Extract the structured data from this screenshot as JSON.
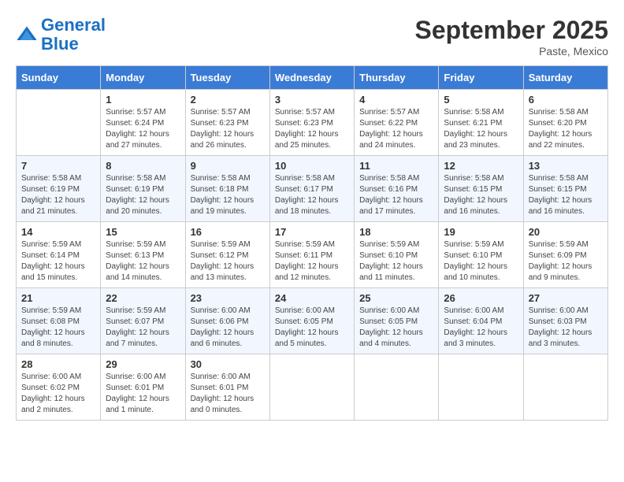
{
  "logo": {
    "line1": "General",
    "line2": "Blue"
  },
  "title": "September 2025",
  "subtitle": "Paste, Mexico",
  "days_of_week": [
    "Sunday",
    "Monday",
    "Tuesday",
    "Wednesday",
    "Thursday",
    "Friday",
    "Saturday"
  ],
  "weeks": [
    [
      {
        "day": "",
        "info": ""
      },
      {
        "day": "1",
        "info": "Sunrise: 5:57 AM\nSunset: 6:24 PM\nDaylight: 12 hours\nand 27 minutes."
      },
      {
        "day": "2",
        "info": "Sunrise: 5:57 AM\nSunset: 6:23 PM\nDaylight: 12 hours\nand 26 minutes."
      },
      {
        "day": "3",
        "info": "Sunrise: 5:57 AM\nSunset: 6:23 PM\nDaylight: 12 hours\nand 25 minutes."
      },
      {
        "day": "4",
        "info": "Sunrise: 5:57 AM\nSunset: 6:22 PM\nDaylight: 12 hours\nand 24 minutes."
      },
      {
        "day": "5",
        "info": "Sunrise: 5:58 AM\nSunset: 6:21 PM\nDaylight: 12 hours\nand 23 minutes."
      },
      {
        "day": "6",
        "info": "Sunrise: 5:58 AM\nSunset: 6:20 PM\nDaylight: 12 hours\nand 22 minutes."
      }
    ],
    [
      {
        "day": "7",
        "info": "Sunrise: 5:58 AM\nSunset: 6:19 PM\nDaylight: 12 hours\nand 21 minutes."
      },
      {
        "day": "8",
        "info": "Sunrise: 5:58 AM\nSunset: 6:19 PM\nDaylight: 12 hours\nand 20 minutes."
      },
      {
        "day": "9",
        "info": "Sunrise: 5:58 AM\nSunset: 6:18 PM\nDaylight: 12 hours\nand 19 minutes."
      },
      {
        "day": "10",
        "info": "Sunrise: 5:58 AM\nSunset: 6:17 PM\nDaylight: 12 hours\nand 18 minutes."
      },
      {
        "day": "11",
        "info": "Sunrise: 5:58 AM\nSunset: 6:16 PM\nDaylight: 12 hours\nand 17 minutes."
      },
      {
        "day": "12",
        "info": "Sunrise: 5:58 AM\nSunset: 6:15 PM\nDaylight: 12 hours\nand 16 minutes."
      },
      {
        "day": "13",
        "info": "Sunrise: 5:58 AM\nSunset: 6:15 PM\nDaylight: 12 hours\nand 16 minutes."
      }
    ],
    [
      {
        "day": "14",
        "info": "Sunrise: 5:59 AM\nSunset: 6:14 PM\nDaylight: 12 hours\nand 15 minutes."
      },
      {
        "day": "15",
        "info": "Sunrise: 5:59 AM\nSunset: 6:13 PM\nDaylight: 12 hours\nand 14 minutes."
      },
      {
        "day": "16",
        "info": "Sunrise: 5:59 AM\nSunset: 6:12 PM\nDaylight: 12 hours\nand 13 minutes."
      },
      {
        "day": "17",
        "info": "Sunrise: 5:59 AM\nSunset: 6:11 PM\nDaylight: 12 hours\nand 12 minutes."
      },
      {
        "day": "18",
        "info": "Sunrise: 5:59 AM\nSunset: 6:10 PM\nDaylight: 12 hours\nand 11 minutes."
      },
      {
        "day": "19",
        "info": "Sunrise: 5:59 AM\nSunset: 6:10 PM\nDaylight: 12 hours\nand 10 minutes."
      },
      {
        "day": "20",
        "info": "Sunrise: 5:59 AM\nSunset: 6:09 PM\nDaylight: 12 hours\nand 9 minutes."
      }
    ],
    [
      {
        "day": "21",
        "info": "Sunrise: 5:59 AM\nSunset: 6:08 PM\nDaylight: 12 hours\nand 8 minutes."
      },
      {
        "day": "22",
        "info": "Sunrise: 5:59 AM\nSunset: 6:07 PM\nDaylight: 12 hours\nand 7 minutes."
      },
      {
        "day": "23",
        "info": "Sunrise: 6:00 AM\nSunset: 6:06 PM\nDaylight: 12 hours\nand 6 minutes."
      },
      {
        "day": "24",
        "info": "Sunrise: 6:00 AM\nSunset: 6:05 PM\nDaylight: 12 hours\nand 5 minutes."
      },
      {
        "day": "25",
        "info": "Sunrise: 6:00 AM\nSunset: 6:05 PM\nDaylight: 12 hours\nand 4 minutes."
      },
      {
        "day": "26",
        "info": "Sunrise: 6:00 AM\nSunset: 6:04 PM\nDaylight: 12 hours\nand 3 minutes."
      },
      {
        "day": "27",
        "info": "Sunrise: 6:00 AM\nSunset: 6:03 PM\nDaylight: 12 hours\nand 3 minutes."
      }
    ],
    [
      {
        "day": "28",
        "info": "Sunrise: 6:00 AM\nSunset: 6:02 PM\nDaylight: 12 hours\nand 2 minutes."
      },
      {
        "day": "29",
        "info": "Sunrise: 6:00 AM\nSunset: 6:01 PM\nDaylight: 12 hours\nand 1 minute."
      },
      {
        "day": "30",
        "info": "Sunrise: 6:00 AM\nSunset: 6:01 PM\nDaylight: 12 hours\nand 0 minutes."
      },
      {
        "day": "",
        "info": ""
      },
      {
        "day": "",
        "info": ""
      },
      {
        "day": "",
        "info": ""
      },
      {
        "day": "",
        "info": ""
      }
    ]
  ]
}
